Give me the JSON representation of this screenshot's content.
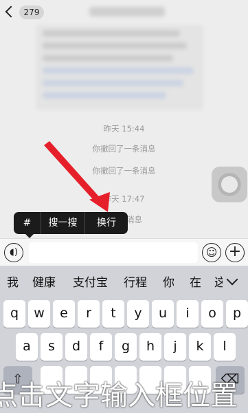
{
  "header": {
    "unread_count": "279"
  },
  "chat": {
    "messages": [
      {
        "time": "昨天 15:44"
      },
      {
        "system": "你撤回了一条消息"
      },
      {
        "system": "你撤回了一条消息"
      },
      {
        "time": "昨天 17:47"
      },
      {
        "system": "一条消息"
      }
    ]
  },
  "context_menu": {
    "items": [
      "#",
      "搜一搜",
      "换行"
    ]
  },
  "input_bar": {
    "voice_icon": "voice-icon",
    "emoji_icon": "emoji-icon",
    "plus_icon": "plus-icon",
    "value": ""
  },
  "keyboard": {
    "candidates": [
      "我",
      "健康",
      "支付宝",
      "行程",
      "你",
      "在",
      "这"
    ],
    "row1": [
      "q",
      "w",
      "e",
      "r",
      "t",
      "y",
      "u",
      "i",
      "o",
      "p"
    ],
    "row2": [
      "a",
      "s",
      "d",
      "f",
      "g",
      "h",
      "j",
      "k",
      "l"
    ],
    "row3_visible": [
      "⇧",
      "⌫"
    ]
  },
  "caption": "点击文字输入框位置",
  "colors": {
    "arrow": "#e6202a",
    "menu_bg": "#1b1b1b",
    "keyboard_bg": "#d1d3d9"
  }
}
